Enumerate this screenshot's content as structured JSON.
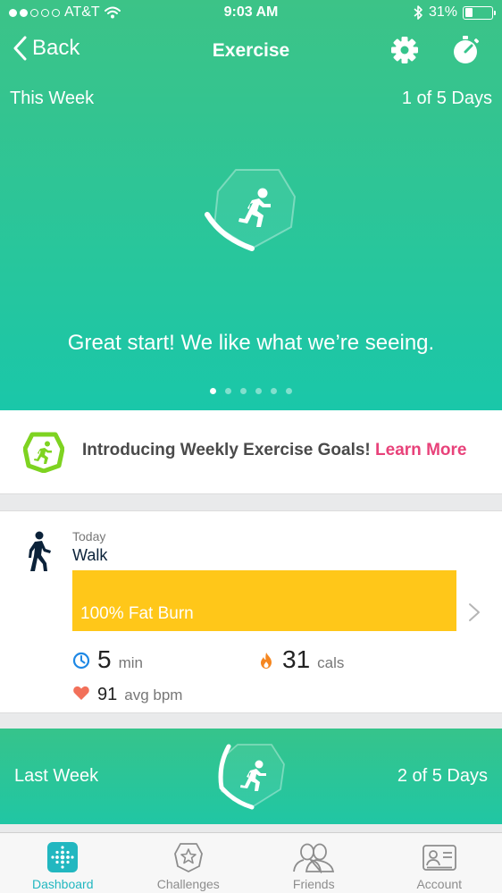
{
  "status_bar": {
    "carrier": "AT&T",
    "time": "9:03 AM",
    "battery": "31%",
    "battery_level": 0.31,
    "signal_bars_filled": 2,
    "signal_bars_total": 5
  },
  "nav": {
    "back_label": "Back",
    "title": "Exercise",
    "settings_icon": "gear-icon",
    "timer_icon": "stopwatch-icon"
  },
  "hero": {
    "week_label": "This Week",
    "days_progress": "1 of 5 Days",
    "progress_fraction": 0.2,
    "message": "Great start! We like what we’re seeing.",
    "page_count": 6,
    "active_page": 1
  },
  "announcement": {
    "text": "Introducing Weekly Exercise Goals!",
    "link": "Learn More"
  },
  "activity": {
    "day": "Today",
    "name": "Walk",
    "zone_label": "100% Fat Burn",
    "zone_fraction": 1.0,
    "duration_value": "5",
    "duration_unit": "min",
    "calories_value": "31",
    "calories_unit": "cals",
    "heart_rate_value": "91",
    "heart_rate_unit": "avg bpm"
  },
  "last_week": {
    "label": "Last Week",
    "days_progress": "2 of 5 Days",
    "progress_fraction": 0.4
  },
  "tabs": [
    {
      "label": "Dashboard",
      "icon": "dashboard-icon",
      "active": true
    },
    {
      "label": "Challenges",
      "icon": "challenges-icon",
      "active": false
    },
    {
      "label": "Friends",
      "icon": "friends-icon",
      "active": false
    },
    {
      "label": "Account",
      "icon": "account-icon",
      "active": false
    }
  ],
  "colors": {
    "accent_green": "#2ec596",
    "fat_burn_yellow": "#ffc719",
    "link_pink": "#e8427a",
    "tab_active": "#22b7c0"
  }
}
